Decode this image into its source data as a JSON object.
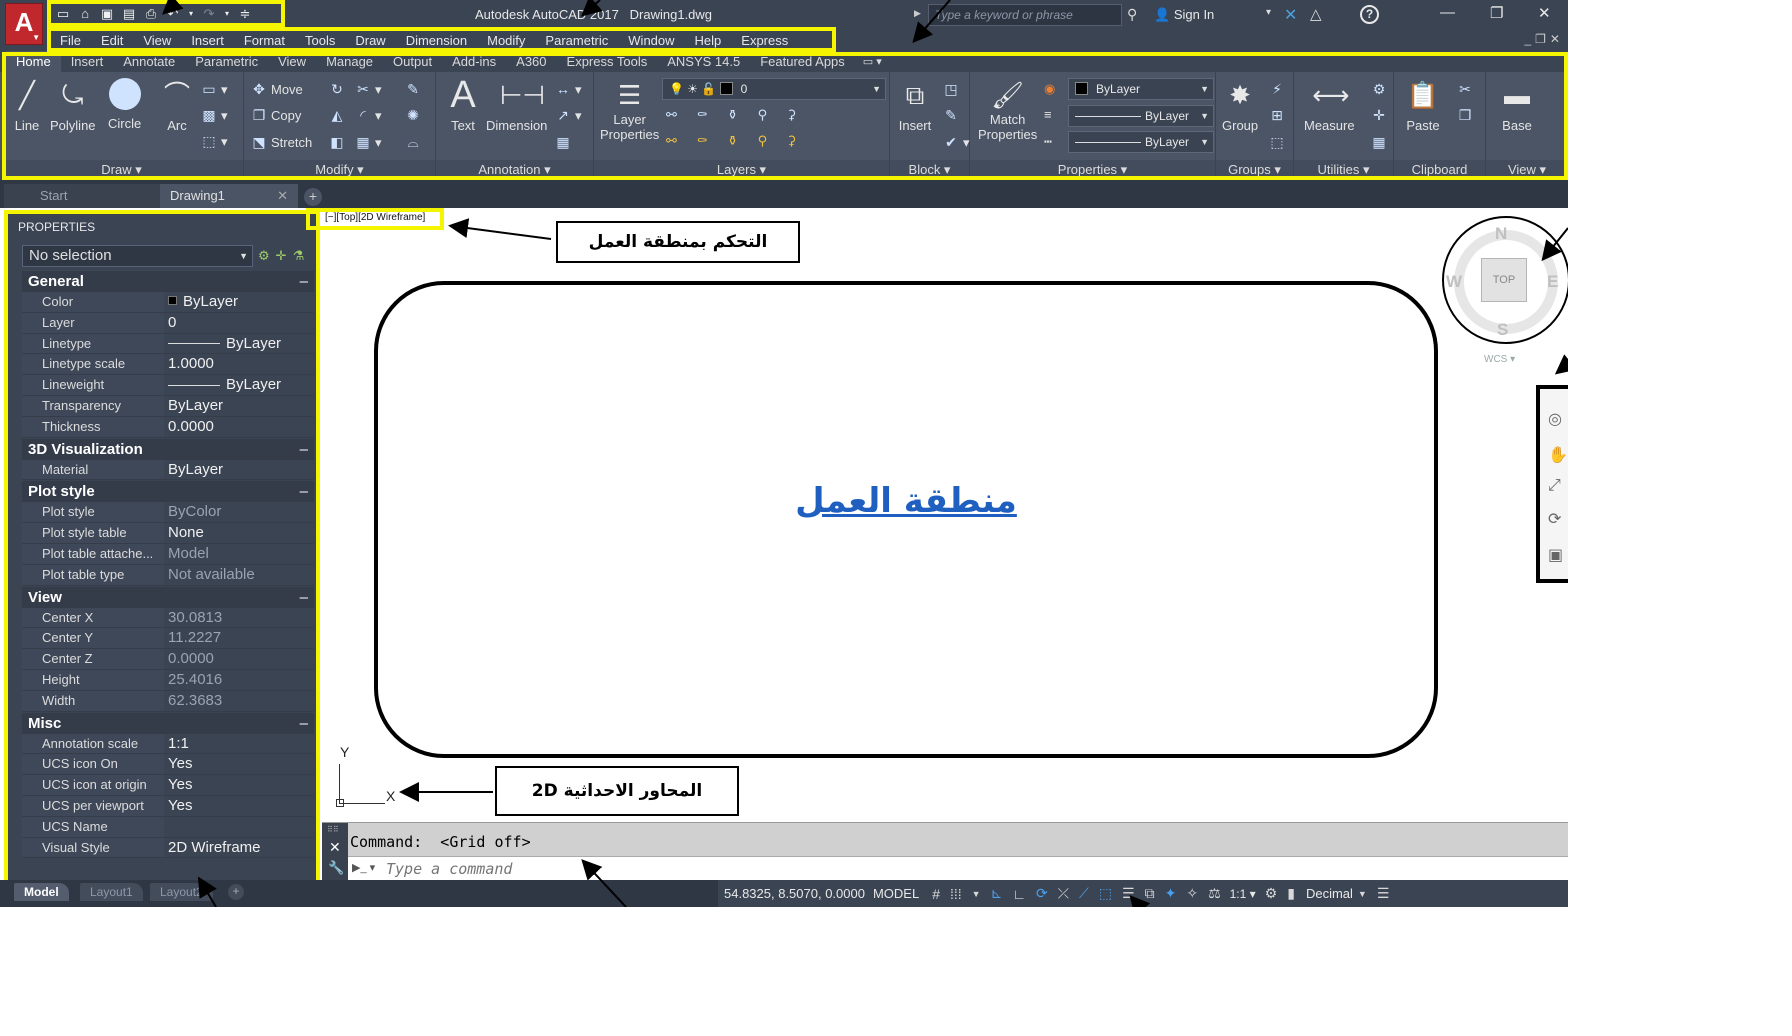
{
  "titlebar": {
    "app_title": "Autodesk AutoCAD 2017   Drawing1.dwg",
    "search_placeholder": "Type a keyword or phrase",
    "signin": "Sign In",
    "logo": "A",
    "qat_icons": [
      "new-icon",
      "open-icon",
      "save-icon",
      "save-as-icon",
      "plot-icon",
      "undo-icon",
      "redo-icon",
      "customize-icon"
    ]
  },
  "menubar": [
    "File",
    "Edit",
    "View",
    "Insert",
    "Format",
    "Tools",
    "Draw",
    "Dimension",
    "Modify",
    "Parametric",
    "Window",
    "Help",
    "Express"
  ],
  "ribbon_tabs": [
    "Home",
    "Insert",
    "Annotate",
    "Parametric",
    "View",
    "Manage",
    "Output",
    "Add-ins",
    "A360",
    "Express Tools",
    "ANSYS 14.5",
    "Featured Apps"
  ],
  "ribbon": {
    "draw": {
      "title": "Draw ▾",
      "line": "Line",
      "polyline": "Polyline",
      "circle": "Circle",
      "arc": "Arc"
    },
    "modify": {
      "title": "Modify ▾",
      "move": "Move",
      "copy": "Copy",
      "stretch": "Stretch"
    },
    "annotation": {
      "title": "Annotation ▾",
      "text": "Text",
      "dimension": "Dimension"
    },
    "layers": {
      "title": "Layers ▾",
      "layer_properties_1": "Layer",
      "layer_properties_2": "Properties",
      "current_layer": "0"
    },
    "block": {
      "title": "Block ▾",
      "insert": "Insert"
    },
    "properties": {
      "title": "Properties ▾",
      "match_1": "Match",
      "match_2": "Properties",
      "color": "ByLayer",
      "linetype": "ByLayer",
      "lineweight": "ByLayer"
    },
    "groups": {
      "title": "Groups ▾",
      "group": "Group"
    },
    "utilities": {
      "title": "Utilities ▾",
      "measure": "Measure"
    },
    "clipboard": {
      "title": "Clipboard",
      "paste": "Paste"
    },
    "view": {
      "title": "View ▾",
      "base": "Base"
    }
  },
  "file_tabs": {
    "start": "Start",
    "drawing": "Drawing1"
  },
  "properties_palette": {
    "title": "PROPERTIES",
    "selection": "No selection",
    "sections": [
      {
        "name": "General",
        "rows": [
          {
            "name": "Color",
            "value": "ByLayer",
            "kind": "swatch"
          },
          {
            "name": "Layer",
            "value": "0"
          },
          {
            "name": "Linetype",
            "value": "ByLayer",
            "kind": "line"
          },
          {
            "name": "Linetype scale",
            "value": "1.0000"
          },
          {
            "name": "Lineweight",
            "value": "ByLayer",
            "kind": "line"
          },
          {
            "name": "Transparency",
            "value": "ByLayer"
          },
          {
            "name": "Thickness",
            "value": "0.0000"
          }
        ]
      },
      {
        "name": "3D Visualization",
        "rows": [
          {
            "name": "Material",
            "value": "ByLayer"
          }
        ]
      },
      {
        "name": "Plot style",
        "rows": [
          {
            "name": "Plot style",
            "value": "ByColor",
            "gray": true
          },
          {
            "name": "Plot style table",
            "value": "None"
          },
          {
            "name": "Plot table attache...",
            "value": "Model",
            "gray": true
          },
          {
            "name": "Plot table type",
            "value": "Not available",
            "gray": true
          }
        ]
      },
      {
        "name": "View",
        "rows": [
          {
            "name": "Center X",
            "value": "30.0813",
            "gray": true
          },
          {
            "name": "Center Y",
            "value": "11.2227",
            "gray": true
          },
          {
            "name": "Center Z",
            "value": "0.0000",
            "gray": true
          },
          {
            "name": "Height",
            "value": "25.4016",
            "gray": true
          },
          {
            "name": "Width",
            "value": "62.3683",
            "gray": true
          }
        ]
      },
      {
        "name": "Misc",
        "rows": [
          {
            "name": "Annotation scale",
            "value": "1:1"
          },
          {
            "name": "UCS icon On",
            "value": "Yes"
          },
          {
            "name": "UCS icon at origin",
            "value": "Yes"
          },
          {
            "name": "UCS per viewport",
            "value": "Yes"
          },
          {
            "name": "UCS Name",
            "value": ""
          },
          {
            "name": "Visual Style",
            "value": "2D Wireframe"
          }
        ]
      }
    ]
  },
  "viewport": {
    "control_label": "[−][Top][2D Wireframe]",
    "workarea_label": "منطقة العمل",
    "callout_viewport": "التحكم بمنطقة العمل",
    "callout_axes": "المحاور الاحداثية 2D",
    "ucs_x": "X",
    "ucs_y": "Y"
  },
  "viewcube": {
    "top": "TOP",
    "n": "N",
    "s": "S",
    "e": "E",
    "w": "W",
    "wcs": "WCS ▾"
  },
  "command": {
    "history": "Command:  <Grid off>",
    "placeholder": "Type a command"
  },
  "statusbar": {
    "layout_tabs": [
      "Model",
      "Layout1",
      "Layout2"
    ],
    "coords": "54.8325, 8.5070, 0.0000",
    "model": "MODEL",
    "scale": "1:1 ▾",
    "units": "Decimal"
  },
  "colors": {
    "dark_ui": "#3b4453",
    "ribbon": "#4b5566",
    "highlight": "#f5f500",
    "workarea_text": "#1f5fbf",
    "logo": "#c0282d"
  }
}
